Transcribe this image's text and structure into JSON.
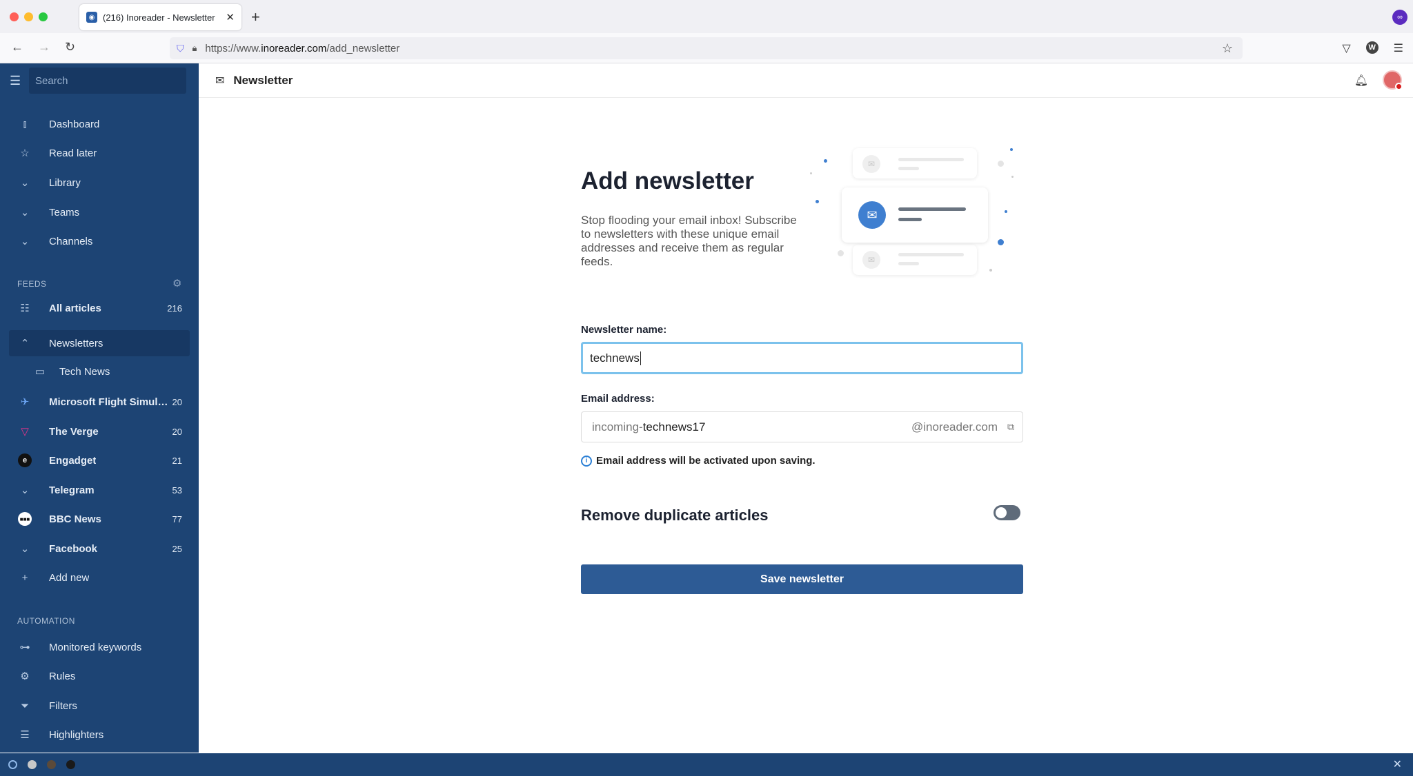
{
  "browser": {
    "tab_title": "(216) Inoreader - Newsletter",
    "url_prefix": "https://www.",
    "url_domain": "inoreader.com",
    "url_path": "/add_newsletter"
  },
  "sidebar": {
    "search_placeholder": "Search",
    "nav": [
      {
        "label": "Dashboard"
      },
      {
        "label": "Read later"
      },
      {
        "label": "Library"
      },
      {
        "label": "Teams"
      },
      {
        "label": "Channels"
      }
    ],
    "feeds_title": "FEEDS",
    "feeds": [
      {
        "label": "All articles",
        "count": "216"
      },
      {
        "label": "Newsletters",
        "count": ""
      },
      {
        "label": "Tech News",
        "count": ""
      },
      {
        "label": "Microsoft Flight Simulat...",
        "count": "20"
      },
      {
        "label": "The Verge",
        "count": "20"
      },
      {
        "label": "Engadget",
        "count": "21"
      },
      {
        "label": "Telegram",
        "count": "53"
      },
      {
        "label": "BBC News",
        "count": "77"
      },
      {
        "label": "Facebook",
        "count": "25"
      },
      {
        "label": "Add new",
        "count": ""
      }
    ],
    "automation_title": "AUTOMATION",
    "automation": [
      {
        "label": "Monitored keywords"
      },
      {
        "label": "Rules"
      },
      {
        "label": "Filters"
      },
      {
        "label": "Highlighters"
      }
    ]
  },
  "header": {
    "title": "Newsletter"
  },
  "main": {
    "title": "Add newsletter",
    "description": "Stop flooding your email inbox! Subscribe to newsletters with these unique email addresses and receive them as regular feeds.",
    "name_label": "Newsletter name:",
    "name_value": "technews",
    "email_label": "Email address:",
    "email_prefix": "incoming-",
    "email_local": "technews17",
    "email_domain": "@inoreader.com",
    "note": "Email address will be activated upon saving.",
    "duplicate_label": "Remove duplicate articles",
    "duplicate_enabled": false,
    "save_label": "Save newsletter"
  },
  "colors": {
    "sidebar_bg": "#1d4474",
    "accent": "#2d5b95",
    "input_focus": "#7cc2ec"
  }
}
